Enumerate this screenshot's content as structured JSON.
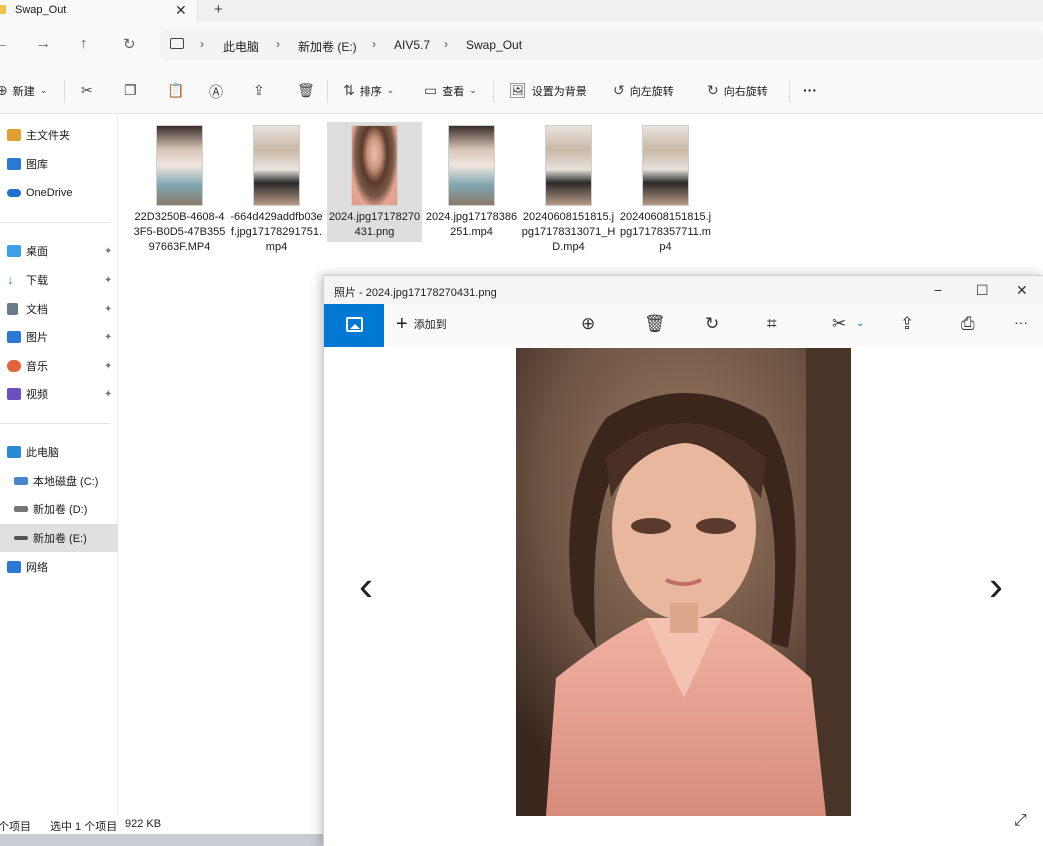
{
  "tab": {
    "title": "Swap_Out",
    "close": "✕",
    "new": "+"
  },
  "nav": {
    "back": "←",
    "forward": "→",
    "up": "↑",
    "refresh": "↻"
  },
  "breadcrumb": [
    "此电脑",
    "新加卷 (E:)",
    "AIV5.7",
    "Swap_Out"
  ],
  "breadcrumb_sep": "›",
  "toolbar": {
    "new_label": "新建",
    "sort_label": "排序",
    "view_label": "查看",
    "set_bg_label": "设置为背景",
    "rotate_left_label": "向左旋转",
    "rotate_right_label": "向右旋转",
    "more": "···"
  },
  "sidebar": {
    "items": [
      {
        "label": "主文件夹",
        "icon": "home-icon",
        "color": "#e0a030"
      },
      {
        "label": "图库",
        "icon": "gallery-icon",
        "color": "#2b78d6"
      },
      {
        "label": "OneDrive",
        "icon": "onedrive-icon",
        "color": "#1f6fd1"
      },
      {
        "label": "桌面",
        "icon": "desktop-icon",
        "color": "#3aa0e8",
        "pinned": true
      },
      {
        "label": "下载",
        "icon": "download-icon",
        "color": "#2a9a4a",
        "pinned": true
      },
      {
        "label": "文档",
        "icon": "document-icon",
        "color": "#6a7b8c",
        "pinned": true
      },
      {
        "label": "图片",
        "icon": "pictures-icon",
        "color": "#2b78d6",
        "pinned": true
      },
      {
        "label": "音乐",
        "icon": "music-icon",
        "color": "#e0643a",
        "pinned": true
      },
      {
        "label": "视频",
        "icon": "video-icon",
        "color": "#6b4fc4",
        "pinned": true
      },
      {
        "label": "此电脑",
        "icon": "pc-icon",
        "color": "#2b8ad6"
      },
      {
        "label": "本地磁盘 (C:)",
        "icon": "drive-icon",
        "color": "#4a86c8"
      },
      {
        "label": "新加卷 (D:)",
        "icon": "drive-icon",
        "color": "#666"
      },
      {
        "label": "新加卷 (E:)",
        "icon": "drive-icon",
        "color": "#555",
        "selected": true
      },
      {
        "label": "网络",
        "icon": "network-icon",
        "color": "#2b78d6"
      }
    ],
    "pin_glyph": "📌"
  },
  "files": [
    {
      "name": "22D3250B-4608-43F5-B0D5-47B35597663F.MP4",
      "type": "video"
    },
    {
      "name": "-664d429addfb03ef.jpg17178291751.mp4",
      "type": "video"
    },
    {
      "name": "2024.jpg17178270431.png",
      "type": "image",
      "selected": true
    },
    {
      "name": "2024.jpg17178386251.mp4",
      "type": "video"
    },
    {
      "name": "20240608151815.jpg17178313071_HD.mp4",
      "type": "video"
    },
    {
      "name": "20240608151815.jpg17178357711.mp4",
      "type": "video"
    }
  ],
  "status": {
    "items": "个项目",
    "selected": "选中 1 个项目",
    "size": "922 KB"
  },
  "photos": {
    "title": "照片 - 2024.jpg17178270431.png",
    "add_label": "添加到",
    "minimize": "−",
    "maximize": "☐",
    "close": "✕",
    "prev": "‹",
    "next": "›",
    "expand": "⤢"
  },
  "colors": {
    "accent": "#0078d4"
  }
}
